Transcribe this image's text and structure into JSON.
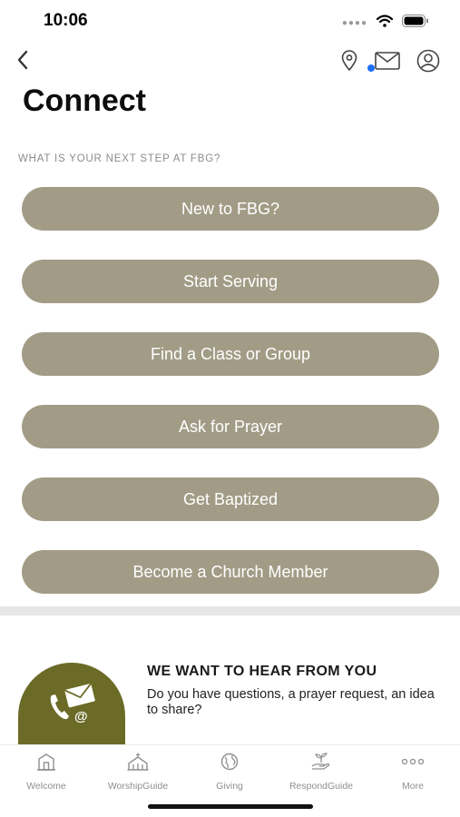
{
  "status_bar": {
    "time": "10:06"
  },
  "nav": {
    "back_icon": "chevron-left-icon",
    "icons": [
      "location-pin-icon",
      "mail-icon",
      "user-profile-icon"
    ],
    "unread_indicator_color": "#1e6ef2"
  },
  "page": {
    "title": "Connect",
    "section_label": "WHAT IS YOUR NEXT STEP AT FBG?"
  },
  "actions": [
    {
      "label": "New to FBG?"
    },
    {
      "label": "Start Serving"
    },
    {
      "label": "Find a Class or Group"
    },
    {
      "label": "Ask for Prayer"
    },
    {
      "label": "Get Baptized"
    },
    {
      "label": "Become a Church Member"
    }
  ],
  "contact": {
    "title": "WE WANT TO HEAR FROM YOU",
    "text": "Do you have questions, a prayer request, an idea to share?",
    "icon": "phone-mail-icon"
  },
  "tabs": [
    {
      "label": "Welcome",
      "icon": "church-building-icon"
    },
    {
      "label": "WorshipGuide",
      "icon": "chapel-icon"
    },
    {
      "label": "Giving",
      "icon": "globe-icon"
    },
    {
      "label": "RespondGuide",
      "icon": "plant-hand-icon"
    },
    {
      "label": "More",
      "icon": "more-dots-icon"
    }
  ],
  "colors": {
    "button_bg": "#a29c86",
    "fab_bg": "#6b6b27",
    "tab_inactive": "#8f8f8f"
  }
}
